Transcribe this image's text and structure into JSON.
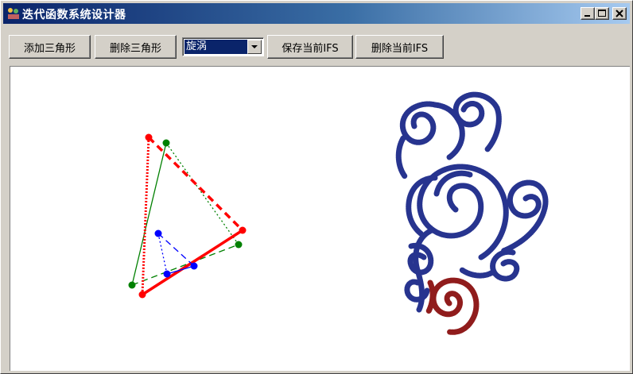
{
  "window": {
    "title": "迭代函数系统设计器",
    "controls": [
      "minimize",
      "maximize",
      "close"
    ]
  },
  "toolbar": {
    "add_triangle_label": "添加三角形",
    "delete_triangle_label": "删除三角形",
    "ifs_select": {
      "selected": "旋涡"
    },
    "save_ifs_label": "保存当前IFS",
    "delete_ifs_label": "删除当前IFS"
  },
  "canvas": {
    "colors": {
      "red": "#ff0000",
      "green": "#008000",
      "blue": "#0000ff",
      "fractal_main": "#1c2a8a",
      "fractal_small": "#8b1010"
    },
    "icons": [
      "app-icon",
      "minimize-icon",
      "maximize-icon",
      "close-icon",
      "dropdown-arrow-icon"
    ]
  }
}
